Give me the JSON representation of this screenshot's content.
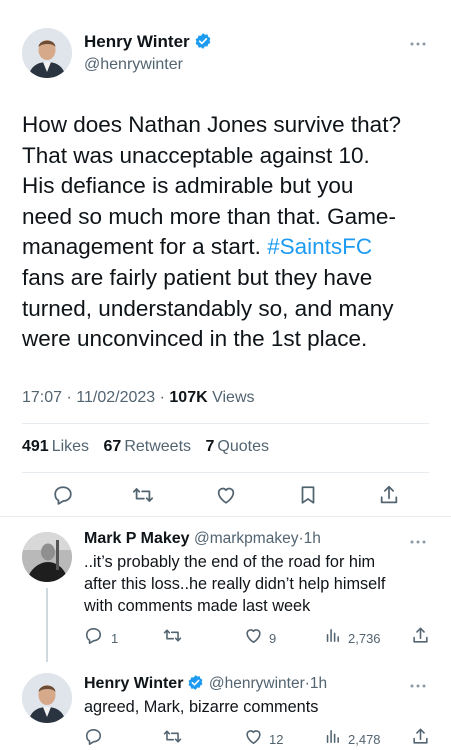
{
  "main_tweet": {
    "author_name": "Henry Winter",
    "author_handle": "@henrywinter",
    "body_lines": [
      "How does Nathan Jones survive that?",
      "That was unacceptable against 10.",
      "His defiance is admirable but you",
      "need so much more than that. Game-"
    ],
    "body_line5_pre": "management for a start. ",
    "body_hashtag": "#SaintsFC",
    "body_lines_after": [
      "fans are fairly patient but they have",
      "turned, understandably so, and many",
      "were unconvinced in the 1st place."
    ],
    "time": "17:07",
    "date": "11/02/2023",
    "views_count": "107K",
    "views_label": "Views",
    "likes_count": "491",
    "likes_label": "Likes",
    "retweets_count": "67",
    "retweets_label": "Retweets",
    "quotes_count": "7",
    "quotes_label": "Quotes"
  },
  "replies": [
    {
      "author_name": "Mark P Makey",
      "author_handle": "@markpmakey",
      "age": "1h",
      "text_lines": [
        "..it’s probably the end of the road for him",
        "after this loss..he really didn’t help himself",
        "with comments made last week"
      ],
      "reply_count": "1",
      "retweet_count": "",
      "like_count": "9",
      "view_count": "2,736"
    },
    {
      "author_name": "Henry Winter",
      "author_handle": "@henrywinter",
      "age": "1h",
      "text_lines": [
        "agreed, Mark, bizarre comments"
      ],
      "reply_count": "",
      "retweet_count": "",
      "like_count": "12",
      "view_count": "2,478"
    }
  ],
  "separator": "·",
  "icons": {
    "more": "more-dots-icon",
    "verified": "verified-badge-icon",
    "reply": "reply-icon",
    "retweet": "retweet-icon",
    "like": "like-icon",
    "bookmark": "bookmark-icon",
    "share": "share-icon",
    "views": "views-chart-icon"
  },
  "colors": {
    "accent": "#1d9bf0",
    "text": "#0f1419",
    "muted": "#536471",
    "divider": "#e6ecf0"
  }
}
